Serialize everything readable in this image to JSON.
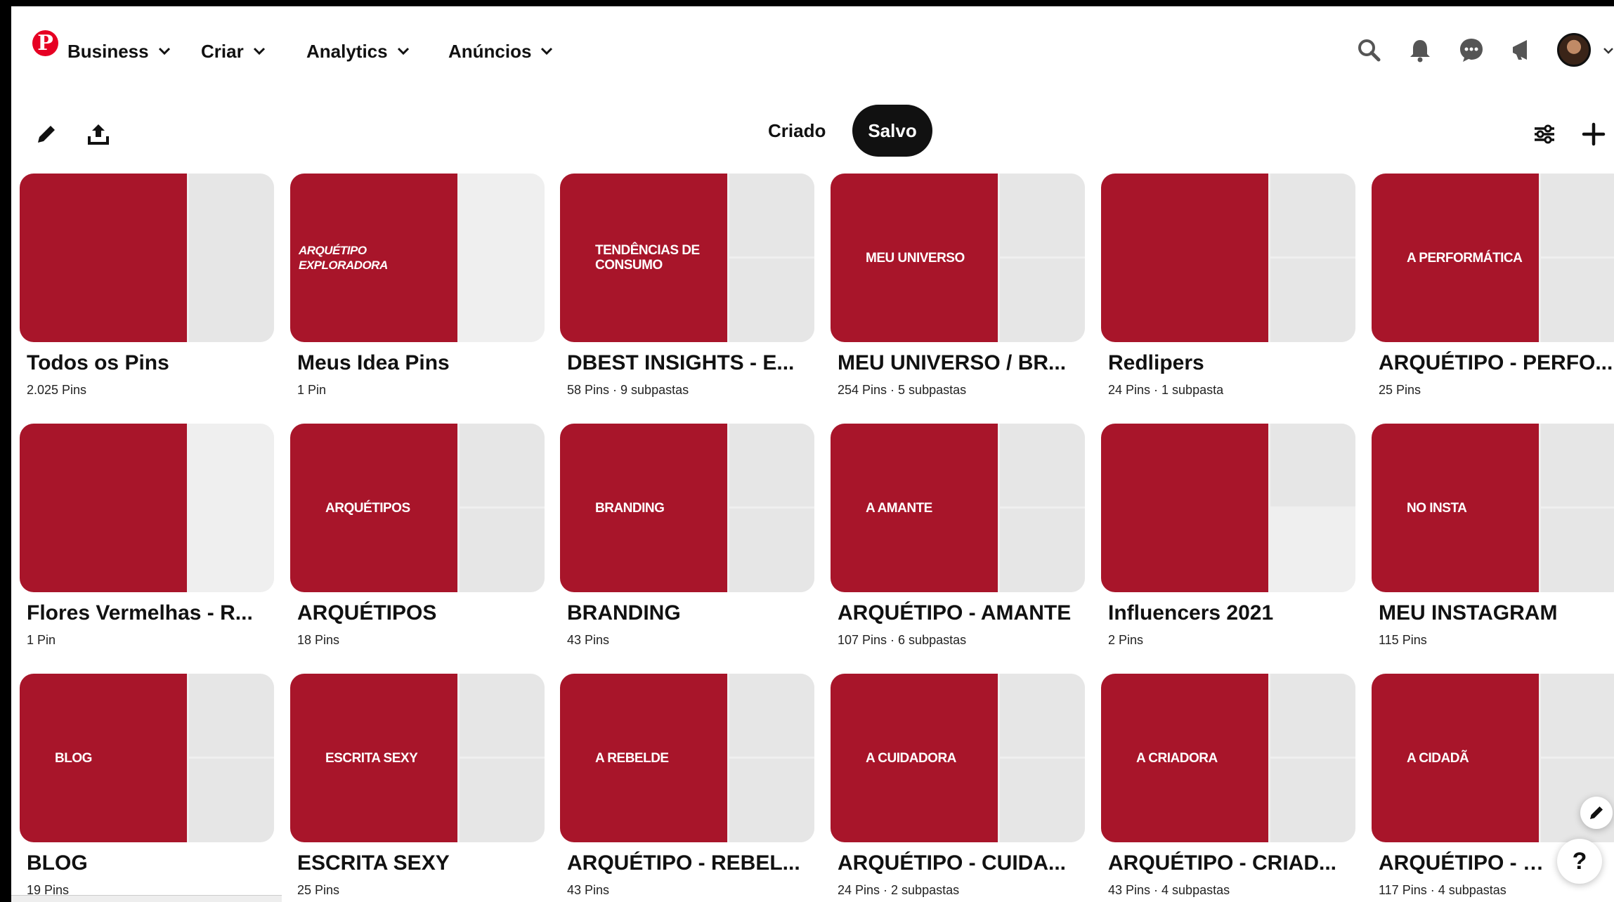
{
  "nav": {
    "items": [
      {
        "label": "Business"
      },
      {
        "label": "Criar"
      },
      {
        "label": "Analytics"
      },
      {
        "label": "Anúncios"
      }
    ]
  },
  "tabs": {
    "created": "Criado",
    "saved": "Salvo"
  },
  "colors": {
    "accent": "#e60023",
    "board_red": "#a8152a"
  },
  "boards": [
    {
      "title": "Todos os Pins",
      "meta": "2.025 Pins",
      "cover_text": ""
    },
    {
      "title": "Meus Idea Pins",
      "meta": "1 Pin",
      "cover_text": "ARQUÉTIPO EXPLORADORA"
    },
    {
      "title": "DBEST INSIGHTS - E...",
      "meta": "58 Pins · 9 subpastas",
      "cover_text": "TENDÊNCIAS DE CONSUMO"
    },
    {
      "title": "MEU UNIVERSO / BR...",
      "meta": "254 Pins · 5 subpastas",
      "cover_text": "MEU UNIVERSO"
    },
    {
      "title": "Redlipers",
      "meta": "24 Pins · 1 subpasta",
      "cover_text": ""
    },
    {
      "title": "ARQUÉTIPO - PERFO...",
      "meta": "25 Pins",
      "cover_text": "A PERFORMÁTICA"
    },
    {
      "title": "Flores Vermelhas - R...",
      "meta": "1 Pin",
      "cover_text": ""
    },
    {
      "title": "ARQUÉTIPOS",
      "meta": "18 Pins",
      "cover_text": "ARQUÉTIPOS"
    },
    {
      "title": "BRANDING",
      "meta": "43 Pins",
      "cover_text": "BRANDING"
    },
    {
      "title": "ARQUÉTIPO - AMANTE",
      "meta": "107 Pins · 6 subpastas",
      "cover_text": "A AMANTE"
    },
    {
      "title": "Influencers 2021",
      "meta": "2 Pins",
      "cover_text": ""
    },
    {
      "title": "MEU INSTAGRAM",
      "meta": "115 Pins",
      "cover_text": "NO INSTA"
    },
    {
      "title": "BLOG",
      "meta": "19 Pins",
      "cover_text": "BLOG"
    },
    {
      "title": "ESCRITA SEXY",
      "meta": "25 Pins",
      "cover_text": "ESCRITA SEXY"
    },
    {
      "title": "ARQUÉTIPO - REBEL...",
      "meta": "43 Pins",
      "cover_text": "A REBELDE"
    },
    {
      "title": "ARQUÉTIPO - CUIDA...",
      "meta": "24 Pins · 2 subpastas",
      "cover_text": "A CUIDADORA"
    },
    {
      "title": "ARQUÉTIPO - CRIAD...",
      "meta": "43 Pins · 4 subpastas",
      "cover_text": "A CRIADORA"
    },
    {
      "title": "ARQUÉTIPO - CID...",
      "meta": "117 Pins · 4 subpastas",
      "cover_text": "A CIDADÃ"
    }
  ],
  "icons": {
    "logo": "pinterest-logo",
    "search": "search-icon",
    "notifications": "bell-icon",
    "messages": "chat-icon",
    "updates": "megaphone-icon",
    "edit": "pencil-icon",
    "share": "upload-icon",
    "filter": "sliders-icon",
    "create": "plus-icon",
    "help": "question-icon"
  },
  "help_label": "?"
}
